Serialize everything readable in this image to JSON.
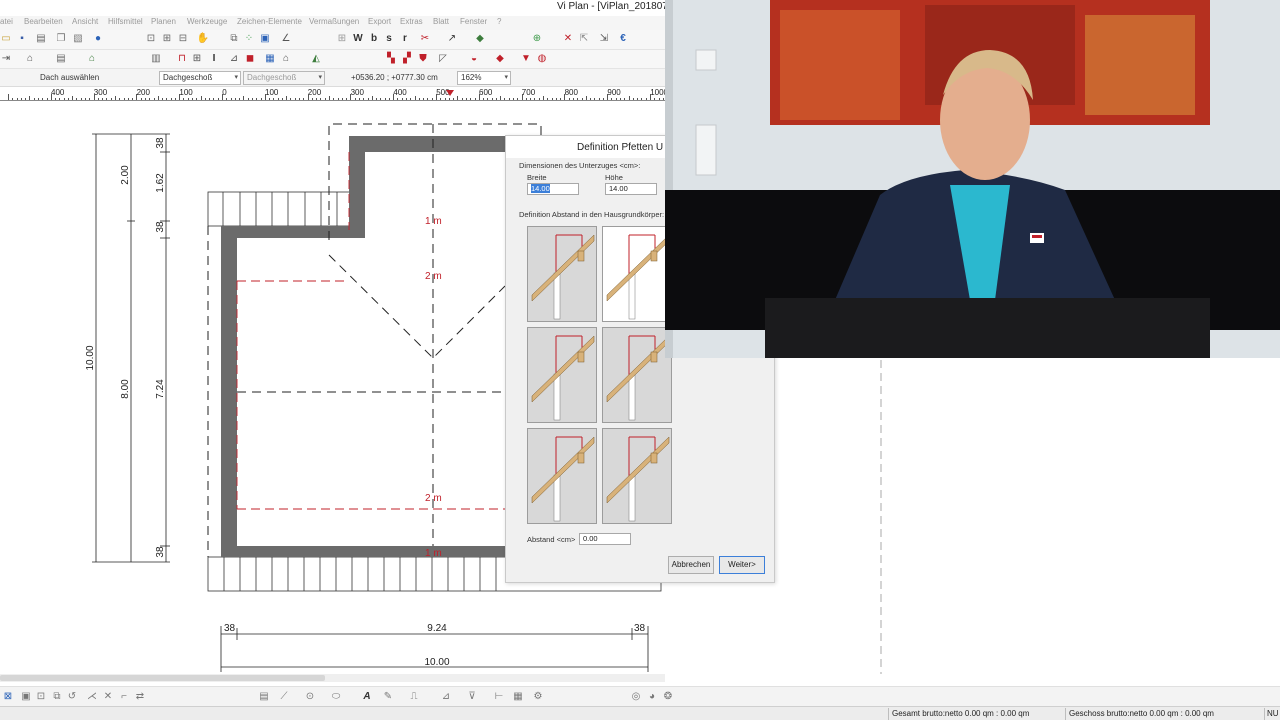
{
  "window": {
    "title": "Vi Plan - [ViPlan_201807"
  },
  "menu": [
    "atei",
    "Bearbeiten",
    "Ansicht",
    "Hilfsmittel",
    "Planen",
    "Werkzeuge",
    "Zeichen-Elemente",
    "Vermaßungen",
    "Export",
    "Extras",
    "Blatt",
    "Fenster",
    "?"
  ],
  "options_bar": {
    "action_label": "Dach auswählen",
    "floor_select": "Dachgeschoß",
    "floor_select_2": "Dachgeschoß",
    "coordinates": "+0536.20 ; +0777.30 cm",
    "zoom": "162%"
  },
  "ruler": {
    "labels": [
      "400",
      "300",
      "200",
      "100",
      "0",
      "100",
      "200",
      "300",
      "400",
      "500",
      "600",
      "700",
      "800",
      "900",
      "1000"
    ]
  },
  "drawing": {
    "left_dims": {
      "total": "10.00",
      "upper": "2.00",
      "lower": "8.00",
      "seg_38_top": "38",
      "seg_162": "1.62",
      "seg_38_mid": "38",
      "seg_724": "7.24",
      "seg_38_bottom": "38"
    },
    "bottom_dims": {
      "left_38": "38",
      "middle": "9.24",
      "right_38": "38",
      "total": "10.00"
    },
    "contour_labels": [
      "1 m",
      "2 m",
      "2 m",
      "1 m"
    ]
  },
  "dialog": {
    "title": "Definition Pfetten U",
    "group_dimensions": "Dimensionen des Unterzuges <cm>:",
    "width_label": "Breite",
    "width_value": "14.00",
    "height_label": "Höhe",
    "height_value": "14.00",
    "group_distance": "Definition Abstand in den Hausgrundkörper:",
    "distance_label": "Abstand <cm>",
    "distance_value": "0.00",
    "cancel_label": "Abbrechen",
    "next_label": "Weiter>"
  },
  "status": {
    "gross_net": "Gesamt brutto:netto 0.00 qm : 0.00 qm",
    "floor_gross_net": "Geschoss brutto:netto 0.00 qm : 0.00 qm",
    "mode": "NU"
  },
  "colors": {
    "wall": "#6b6b6b",
    "dimension_red": "#c0202a",
    "rafter": "#d8b27a",
    "selection": "#3c7fd9"
  },
  "icons": {
    "toolbar1": [
      "new-icon",
      "open-icon",
      "save-icon",
      "print-icon",
      "copy-icon",
      "paste-icon",
      "undo-icon",
      "help-icon",
      "zoom-window-icon",
      "zoom-in-icon",
      "zoom-out-icon",
      "pan-hand-icon",
      "snap-icon",
      "grid-icon",
      "dimension-icon",
      "text-w-icon",
      "text-b-icon",
      "text-s-icon",
      "text-r-icon",
      "scissors-icon",
      "layer-icon",
      "fill-icon",
      "check-icon",
      "delete-icon",
      "export-icon",
      "euro-icon"
    ],
    "toolbar2": [
      "home-icon",
      "printer-icon",
      "wall-icon",
      "door-icon",
      "window-icon",
      "roof-icon",
      "stair-icon",
      "column-icon",
      "beam-icon",
      "slab-icon"
    ]
  }
}
